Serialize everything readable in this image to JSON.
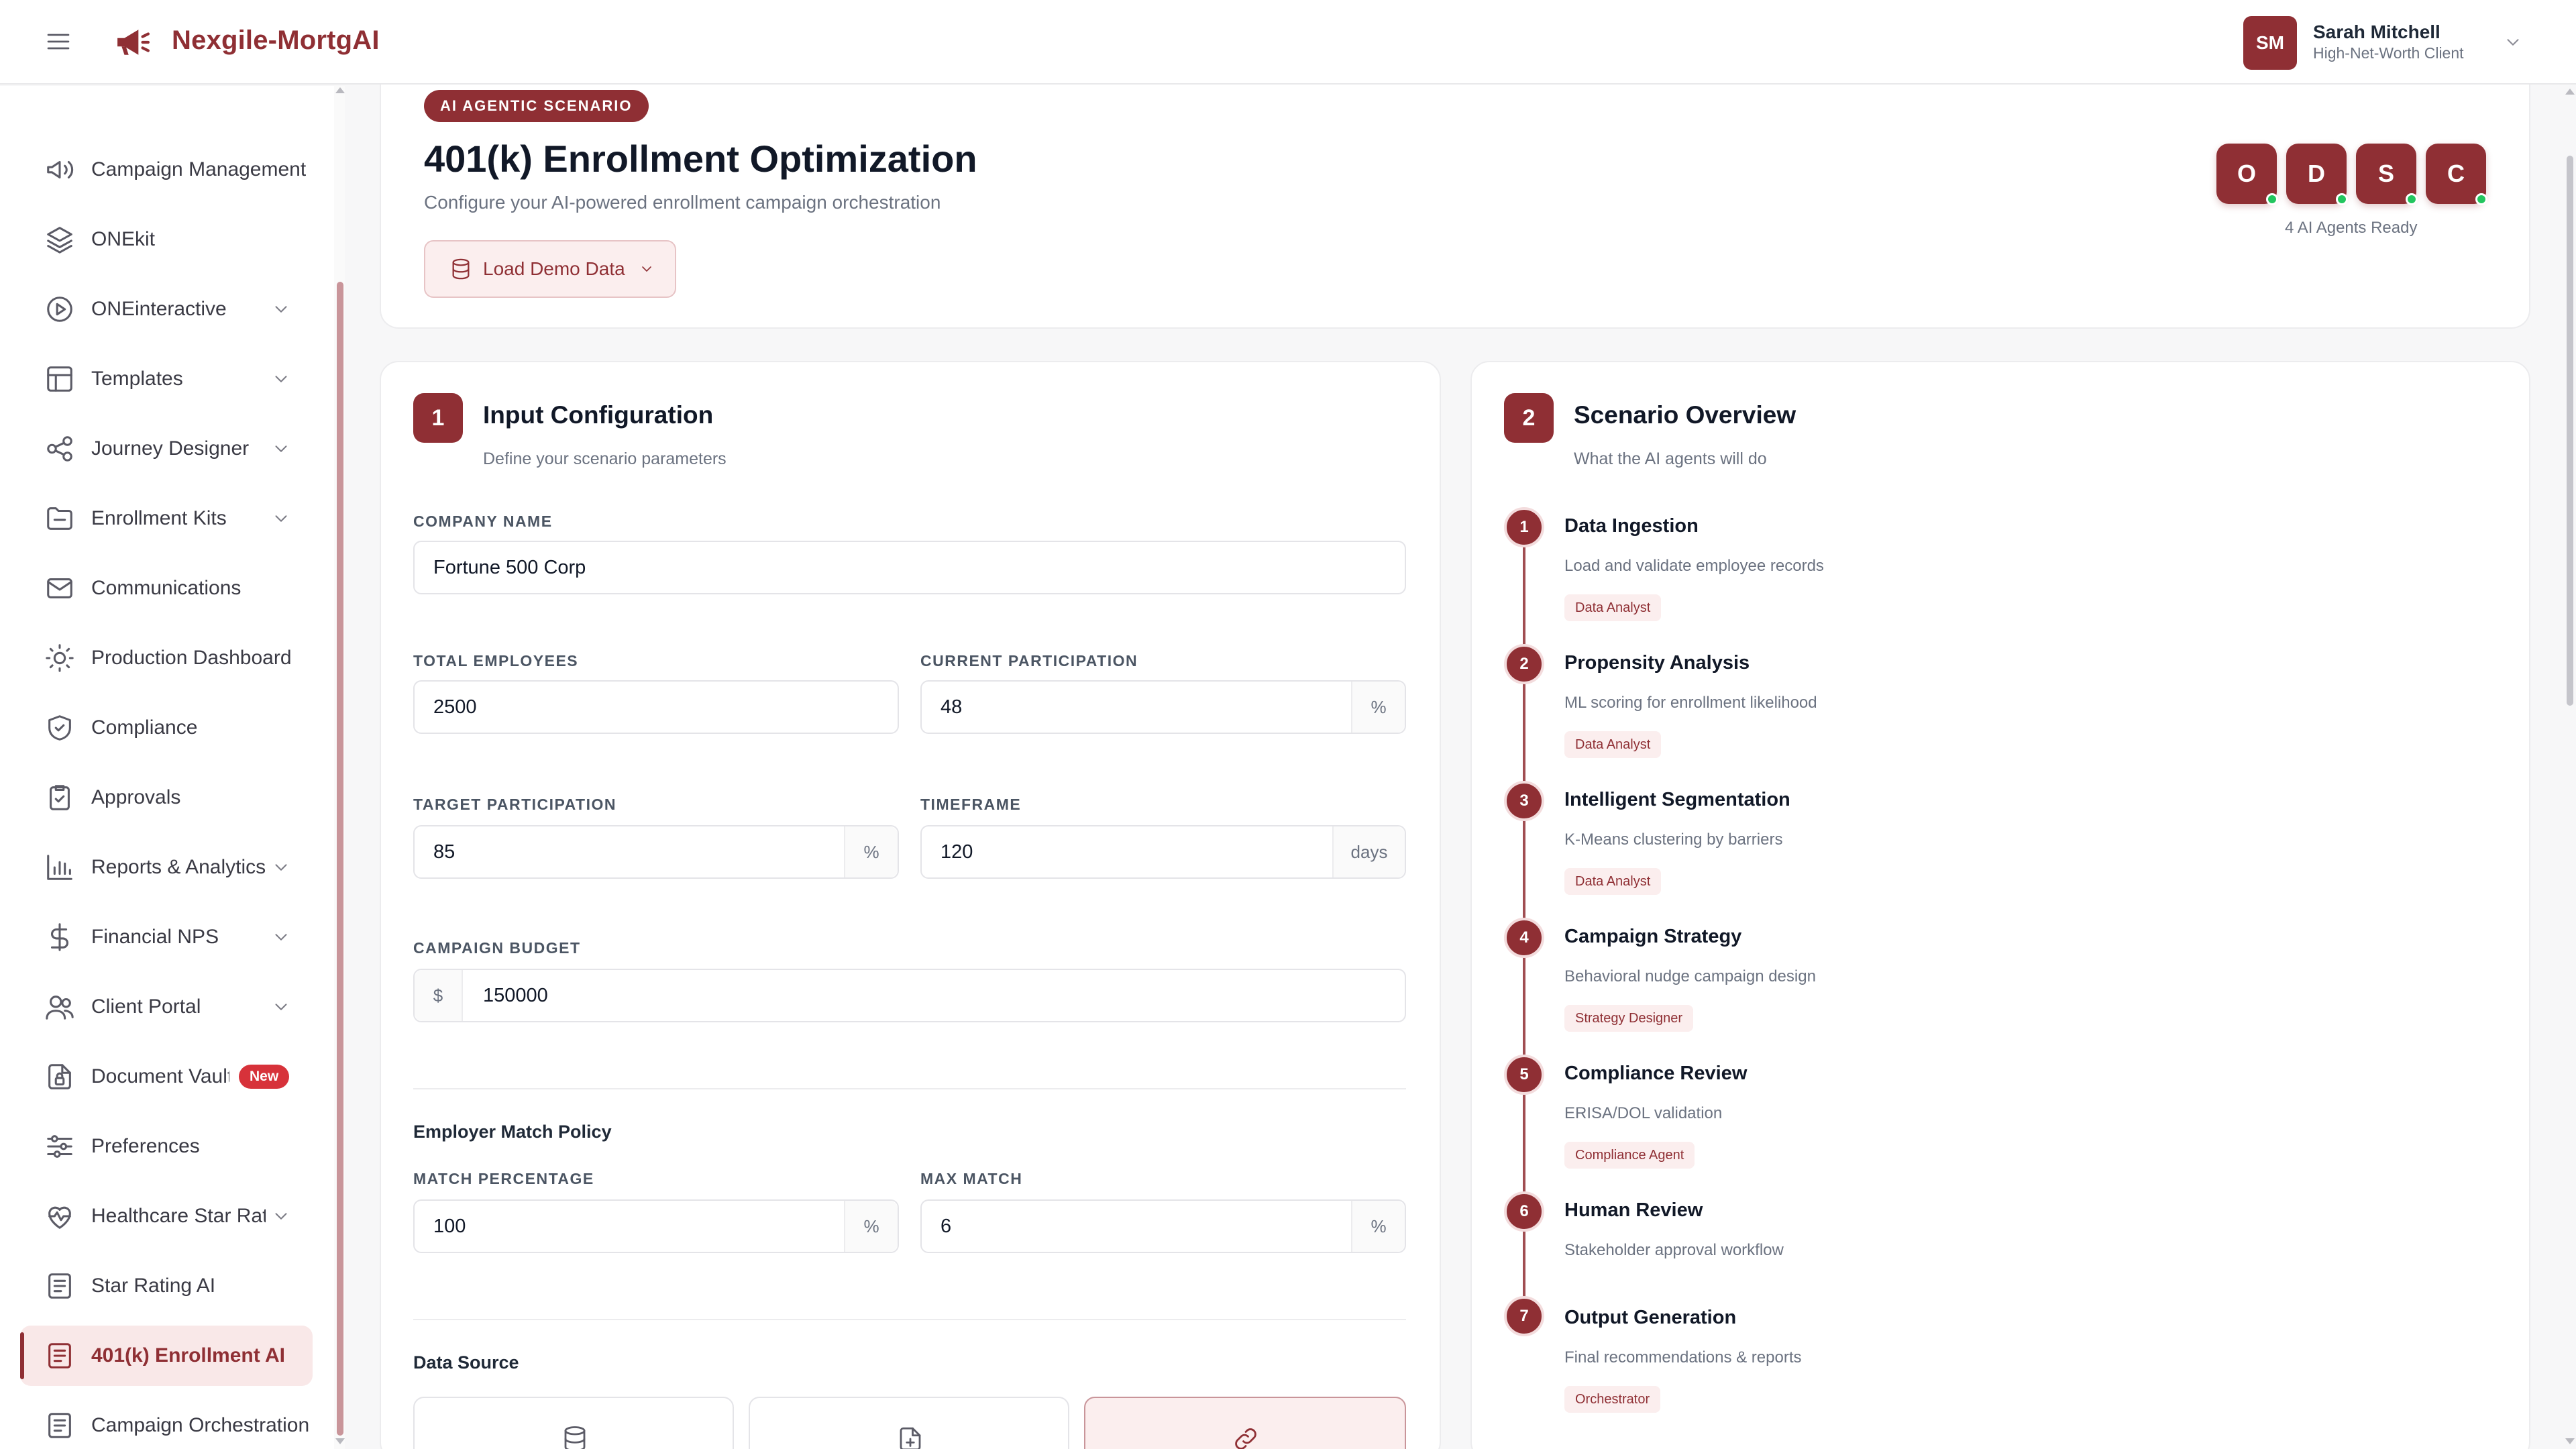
{
  "app": {
    "brand": "Nexgile-MortgAI",
    "accent_color": "#8f2f34"
  },
  "user": {
    "initials": "SM",
    "name": "Sarah Mitchell",
    "role": "High-Net-Worth Client"
  },
  "sidebar": {
    "items": [
      {
        "label": "Campaign Management",
        "icon": "megaphone-icon",
        "chevron": false
      },
      {
        "label": "ONEkit",
        "icon": "layers-icon",
        "chevron": false
      },
      {
        "label": "ONEinteractive",
        "icon": "play-circle-icon",
        "chevron": true
      },
      {
        "label": "Templates",
        "icon": "layout-icon",
        "chevron": true
      },
      {
        "label": "Journey Designer",
        "icon": "share-nodes-icon",
        "chevron": true
      },
      {
        "label": "Enrollment Kits",
        "icon": "folder-icon",
        "chevron": true
      },
      {
        "label": "Communications",
        "icon": "mail-icon",
        "chevron": false
      },
      {
        "label": "Production Dashboard",
        "icon": "sun-icon",
        "chevron": false
      },
      {
        "label": "Compliance",
        "icon": "shield-check-icon",
        "chevron": false
      },
      {
        "label": "Approvals",
        "icon": "clipboard-check-icon",
        "chevron": false
      },
      {
        "label": "Reports & Analytics",
        "icon": "bar-chart-icon",
        "chevron": true
      },
      {
        "label": "Financial NPS",
        "icon": "dollar-icon",
        "chevron": true
      },
      {
        "label": "Client Portal",
        "icon": "users-icon",
        "chevron": true
      },
      {
        "label": "Document Vault",
        "icon": "file-lock-icon",
        "chevron": false,
        "badge": "New"
      },
      {
        "label": "Preferences",
        "icon": "sliders-icon",
        "chevron": false
      },
      {
        "label": "Healthcare Star Ratings",
        "icon": "heart-pulse-icon",
        "chevron": true
      },
      {
        "label": "Star Rating AI",
        "icon": "file-text-icon",
        "chevron": false
      },
      {
        "label": "401(k) Enrollment AI",
        "icon": "file-text-icon",
        "chevron": false,
        "active": true
      },
      {
        "label": "Campaign Orchestration",
        "icon": "file-text-icon",
        "chevron": false
      }
    ]
  },
  "hero": {
    "tag": "AI AGENTIC SCENARIO",
    "title": "401(k) Enrollment Optimization",
    "subtitle": "Configure your AI-powered enrollment campaign orchestration",
    "demo_button": "Load Demo Data",
    "agents": [
      "O",
      "D",
      "S",
      "C"
    ],
    "agents_caption": "4 AI Agents Ready"
  },
  "config": {
    "step": "1",
    "title": "Input Configuration",
    "subtitle": "Define your scenario parameters",
    "company_name_label": "COMPANY NAME",
    "company_name": "Fortune 500 Corp",
    "total_employees_label": "TOTAL EMPLOYEES",
    "total_employees": "2500",
    "current_participation_label": "CURRENT PARTICIPATION",
    "current_participation": "48",
    "target_participation_label": "TARGET PARTICIPATION",
    "target_participation": "85",
    "timeframe_label": "TIMEFRAME",
    "timeframe": "120",
    "campaign_budget_label": "CAMPAIGN BUDGET",
    "campaign_budget": "150000",
    "percent_unit": "%",
    "days_unit": "days",
    "currency_unit": "$",
    "match_policy_heading": "Employer Match Policy",
    "match_percentage_label": "MATCH PERCENTAGE",
    "match_percentage": "100",
    "max_match_label": "MAX MATCH",
    "max_match": "6",
    "data_source_heading": "Data Source"
  },
  "overview": {
    "step": "2",
    "title": "Scenario Overview",
    "subtitle": "What the AI agents will do",
    "steps": [
      {
        "n": "1",
        "title": "Data Ingestion",
        "desc": "Load and validate employee records",
        "tag": "Data Analyst"
      },
      {
        "n": "2",
        "title": "Propensity Analysis",
        "desc": "ML scoring for enrollment likelihood",
        "tag": "Data Analyst"
      },
      {
        "n": "3",
        "title": "Intelligent Segmentation",
        "desc": "K-Means clustering by barriers",
        "tag": "Data Analyst"
      },
      {
        "n": "4",
        "title": "Campaign Strategy",
        "desc": "Behavioral nudge campaign design",
        "tag": "Strategy Designer"
      },
      {
        "n": "5",
        "title": "Compliance Review",
        "desc": "ERISA/DOL validation",
        "tag": "Compliance Agent"
      },
      {
        "n": "6",
        "title": "Human Review",
        "desc": "Stakeholder approval workflow",
        "tag": ""
      },
      {
        "n": "7",
        "title": "Output Generation",
        "desc": "Final recommendations & reports",
        "tag": "Orchestrator"
      }
    ]
  }
}
